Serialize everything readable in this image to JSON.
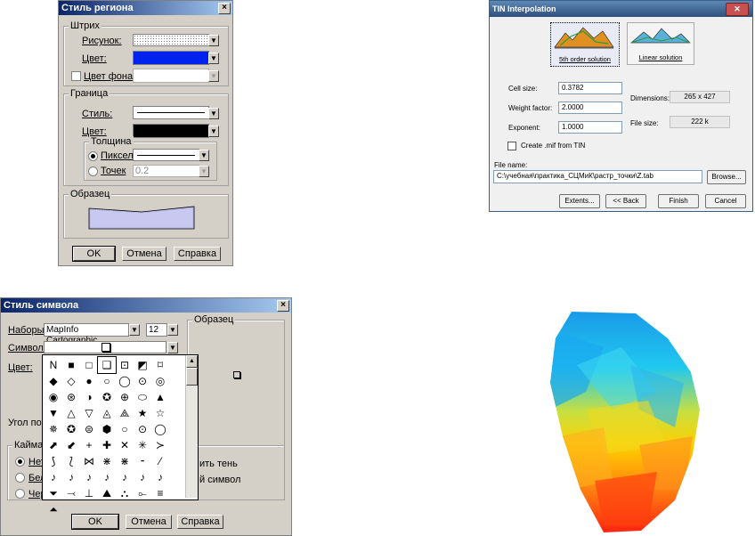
{
  "region_dialog": {
    "title": "Стиль региона",
    "close": "×",
    "stroke_group": "Штрих",
    "pattern_label": "Рисунок:",
    "color_label": "Цвет:",
    "color_value": "#0022ee",
    "bg_color_label": "Цвет фона:",
    "border_group": "Граница",
    "style_label": "Стиль:",
    "border_color_label": "Цвет:",
    "thickness_group": "Толщина",
    "pixel_label": "Пиксел",
    "points_label": "Точек",
    "points_value": "0.2",
    "sample_group": "Образец",
    "ok": "OK",
    "cancel": "Отмена",
    "help": "Справка"
  },
  "tin_dialog": {
    "title": "TIN Interpolation",
    "close": "✕",
    "option_5th": "5th order solution",
    "option_linear": "Linear solution",
    "cell_size_label": "Cell size:",
    "cell_size_value": "0.3782",
    "weight_label": "Weight factor:",
    "weight_value": "2.0000",
    "exponent_label": "Exponent:",
    "exponent_value": "1.0000",
    "dimensions_label": "Dimensions:",
    "dimensions_value": "265 x 427",
    "filesize_label": "File size:",
    "filesize_value": "222 k",
    "create_mif_label": "Create .mif from TIN",
    "filename_label": "File name:",
    "filename_value": "C:\\учебная\\практика_СЦМиК\\растр_точки\\Z.tab",
    "browse": "Browse...",
    "extents": "Extents...",
    "back": "<< Back",
    "finish": "Finish",
    "cancel": "Cancel"
  },
  "symbol_dialog": {
    "title": "Стиль символа",
    "close": "×",
    "sets_label": "Наборы:",
    "font_value": "MapInfo Cartographic",
    "size_value": "12",
    "symbol_label": "Символ:",
    "color_label": "Цвет:",
    "angle_label": "Угол пов",
    "sample_group": "Образец",
    "border_group": "Кайма",
    "radio1": "Нет",
    "radio2": "Бел",
    "radio3": "Чер",
    "shadow_label": "ить тень",
    "symbol_text": "й символ",
    "symbols": [
      "N",
      "■",
      "□",
      "❑",
      "⊡",
      "◩",
      "⌑",
      "◆",
      "◇",
      "●",
      "○",
      "◯",
      "⊙",
      "◎",
      "◉",
      "⊛",
      "◑",
      "✪",
      "⊕",
      "⬭",
      "▲",
      "▼",
      "△",
      "▽",
      "◬",
      "⟁",
      "★",
      "☆",
      "✵",
      "✪",
      "⊜",
      "⬢",
      "○",
      "⊙",
      "◯",
      "⬈",
      "⬋",
      "+",
      "✚",
      "✕",
      "✳",
      "≻",
      "⟆",
      "⟅",
      "⋈",
      "⋇",
      "⋇",
      "⁃",
      "⁄",
      "♪",
      "♪",
      "♪",
      "♪",
      "♪",
      "♪",
      "♪",
      "⏷",
      "⤙",
      "⊥",
      "⛰",
      "⛬",
      "⟜",
      "≡",
      "⏶"
    ],
    "ok": "OK",
    "cancel": "Отмена",
    "help": "Справка"
  },
  "colors": {
    "xp_title": "#0a246a",
    "vista_title": "#3b5f8c",
    "selected_blue": "#0022ee"
  }
}
